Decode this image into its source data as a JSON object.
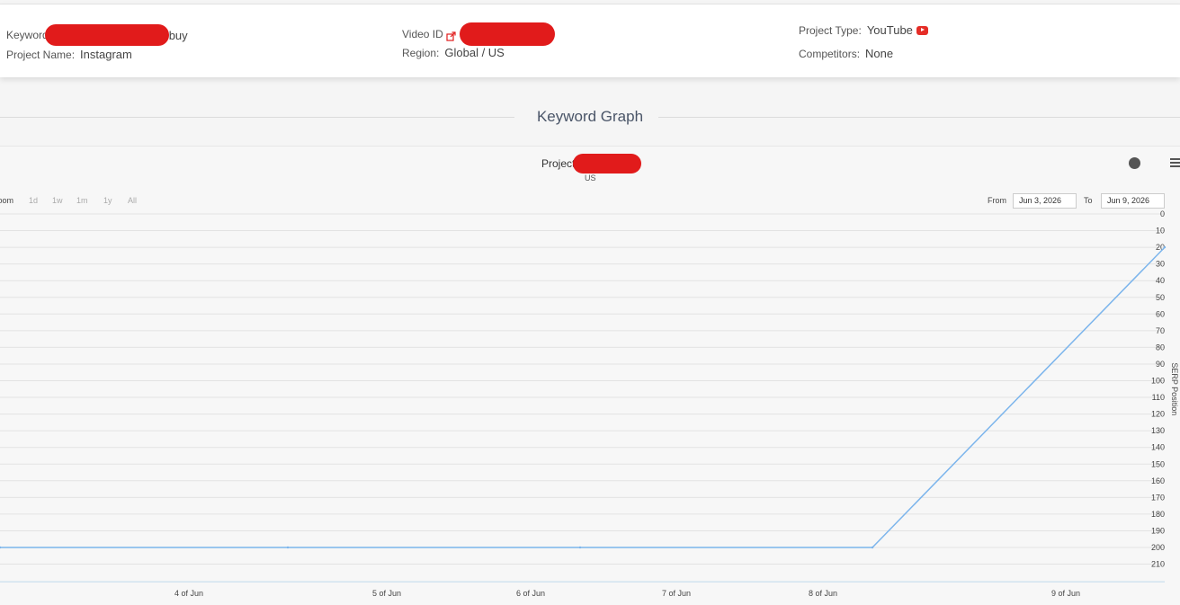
{
  "info": {
    "keyword_label": "Keyword",
    "keyword_value_suffix": "buy",
    "project_name_label": "Project Name:",
    "project_name_value": "Instagram",
    "video_id_label": "Video ID",
    "region_label": "Region:",
    "region_value": "Global / US",
    "project_type_label": "Project Type:",
    "project_type_value": "YouTube",
    "competitors_label": "Competitors:",
    "competitors_value": "None"
  },
  "section": {
    "title": "Keyword Graph"
  },
  "chart_header": {
    "title": "Project",
    "subtitle": "US"
  },
  "controls": {
    "zoom_label": "Zoom",
    "zoom_buttons": [
      "1d",
      "1w",
      "1m",
      "1y",
      "All"
    ],
    "from_label": "From",
    "from_value": "Jun 3, 2026",
    "to_label": "To",
    "to_value": "Jun 9, 2026"
  },
  "colors": {
    "series": "#7cb5ec",
    "redaction": "#e11b1b",
    "youtube": "#e52d27"
  },
  "icons": {
    "video_link": "external-link-icon",
    "project_type": "youtube-icon",
    "chart_status": "record-dot-icon",
    "chart_menu": "hamburger-menu-icon"
  },
  "chart_data": {
    "type": "line",
    "title": "Project",
    "subtitle": "US",
    "ylabel": "SERP Position",
    "y_reversed": true,
    "ylim": [
      0,
      210
    ],
    "y_ticks": [
      0,
      10,
      20,
      30,
      40,
      50,
      60,
      70,
      80,
      90,
      100,
      110,
      120,
      130,
      140,
      150,
      160,
      170,
      180,
      190,
      200,
      210
    ],
    "x_ticks": [
      "4 of Jun",
      "5 of Jun",
      "6 of Jun",
      "7 of Jun",
      "8 of Jun",
      "9 of Jun"
    ],
    "grid": true,
    "series": [
      {
        "x": [
          "Jun 3",
          "Jun 4",
          "Jun 6",
          "Jun 8",
          "Jun 9"
        ],
        "values": [
          200,
          200,
          200,
          200,
          20
        ]
      }
    ]
  }
}
